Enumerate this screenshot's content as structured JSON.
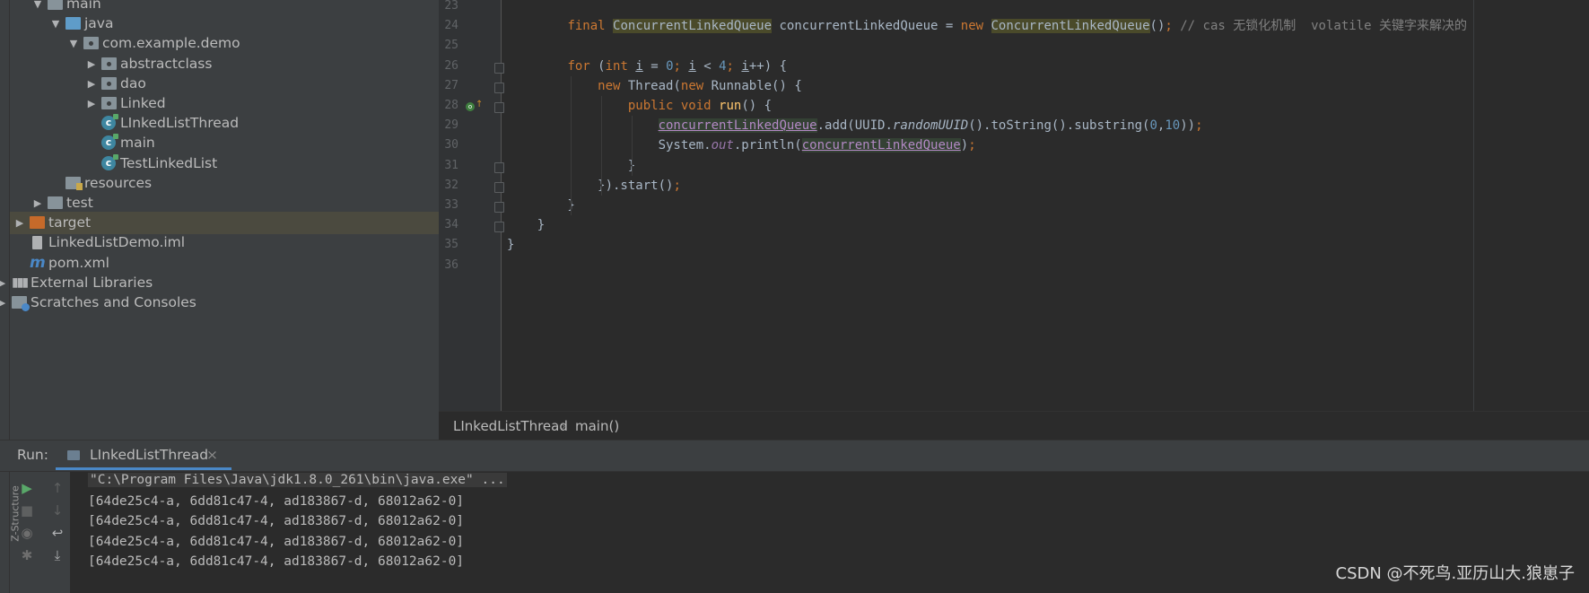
{
  "project_tree": [
    {
      "label": "main",
      "indent": 1,
      "expand": "open",
      "icon": "folder-icon",
      "icon_color": "gray"
    },
    {
      "label": "java",
      "indent": 2,
      "expand": "open",
      "icon": "folder-icon",
      "icon_color": "blue"
    },
    {
      "label": "com.example.demo",
      "indent": 3,
      "expand": "open",
      "icon": "package-icon",
      "icon_color": "gray"
    },
    {
      "label": "abstractclass",
      "indent": 4,
      "expand": "closed",
      "icon": "package-icon",
      "icon_color": "gray"
    },
    {
      "label": "dao",
      "indent": 4,
      "expand": "closed",
      "icon": "package-icon",
      "icon_color": "gray"
    },
    {
      "label": "Linked",
      "indent": 4,
      "expand": "closed",
      "icon": "package-icon",
      "icon_color": "gray"
    },
    {
      "label": "LInkedListThread",
      "indent": 4,
      "expand": "none",
      "icon": "class-icon",
      "icon_color": "teal"
    },
    {
      "label": "main",
      "indent": 4,
      "expand": "none",
      "icon": "class-icon",
      "icon_color": "teal"
    },
    {
      "label": "TestLinkedList",
      "indent": 4,
      "expand": "none",
      "icon": "class-icon",
      "icon_color": "teal"
    },
    {
      "label": "resources",
      "indent": 2,
      "expand": "none",
      "icon": "resources-folder-icon",
      "icon_color": "gray"
    },
    {
      "label": "test",
      "indent": 1,
      "expand": "closed",
      "icon": "folder-icon",
      "icon_color": "gray"
    },
    {
      "label": "target",
      "indent": 0,
      "expand": "closed",
      "icon": "folder-icon",
      "icon_color": "orange",
      "selected": true
    },
    {
      "label": "LinkedListDemo.iml",
      "indent": 0,
      "expand": "none",
      "icon": "iml-file-icon",
      "icon_color": "gray"
    },
    {
      "label": "pom.xml",
      "indent": 0,
      "expand": "none",
      "icon": "maven-icon",
      "icon_color": "blue"
    },
    {
      "label": "External Libraries",
      "indent": -1,
      "expand": "closed",
      "icon": "libraries-icon",
      "icon_color": "gray"
    },
    {
      "label": "Scratches and Consoles",
      "indent": -1,
      "expand": "closed",
      "icon": "scratches-icon",
      "icon_color": "gray"
    }
  ],
  "editor": {
    "line_numbers": [
      "23",
      "24",
      "25",
      "26",
      "27",
      "28",
      "29",
      "30",
      "31",
      "32",
      "33",
      "34",
      "35",
      "36"
    ],
    "lines": [
      "",
      "        final ConcurrentLinkedQueue concurrentLinkedQueue = new ConcurrentLinkedQueue(); // cas 无锁化机制  volatile 关键字来解决的",
      "",
      "        for (int i = 0; i < 4; i++) {",
      "            new Thread(new Runnable() {",
      "                public void run() {",
      "                    concurrentLinkedQueue.add(UUID.randomUUID().toString().substring(0,10));",
      "                    System.out.println(concurrentLinkedQueue);",
      "                }",
      "            }).start();",
      "        }",
      "    }",
      "}",
      ""
    ]
  },
  "breadcrumb": {
    "class_name": "LInkedListThread",
    "separator": "›",
    "method": "main()"
  },
  "run_panel": {
    "label": "Run:",
    "tab_title": "LInkedListThread",
    "tab_close": "×",
    "command": "\"C:\\Program Files\\Java\\jdk1.8.0_261\\bin\\java.exe\" ...",
    "output": [
      "[64de25c4-a, 6dd81c47-4, ad183867-d, 68012a62-0]",
      "[64de25c4-a, 6dd81c47-4, ad183867-d, 68012a62-0]",
      "[64de25c4-a, 6dd81c47-4, ad183867-d, 68012a62-0]",
      "[64de25c4-a, 6dd81c47-4, ad183867-d, 68012a62-0]"
    ],
    "side_label": "Z-Structure"
  },
  "watermark": "CSDN @不死鸟.亚历山大.狼崽子",
  "colors": {
    "editor_bg": "#2b2b2b",
    "panel_bg": "#3c3f41",
    "keyword": "#cc7832",
    "number": "#6897bb",
    "comment": "#808080",
    "field": "#9876aa",
    "method": "#ffc66d",
    "selection": "#4b4a3f",
    "run_green": "#59a869"
  }
}
